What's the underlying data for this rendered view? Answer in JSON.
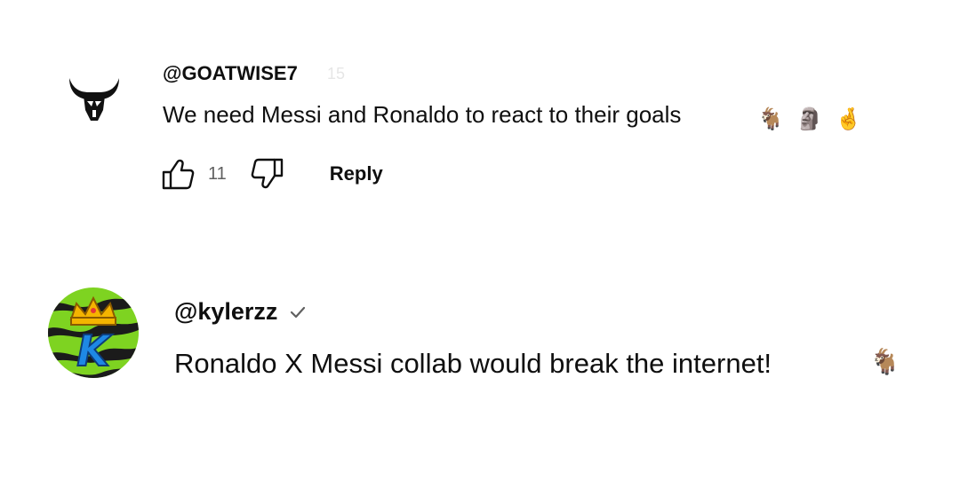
{
  "comments": [
    {
      "author": "@GOATWISE7",
      "timestamp": "15",
      "text": "We need Messi and Ronaldo to react to their goals",
      "emojis": [
        "🐐",
        "🗿",
        "🤞"
      ],
      "avatar_icon": "bull-horns-icon",
      "like_count": "11",
      "reply_label": "Reply"
    },
    {
      "author": "@kylerzz",
      "verified": true,
      "text": "Ronaldo X Messi collab would break the internet!",
      "emojis": [
        "🐐"
      ],
      "avatar_icon": "crowned-k-logo-icon",
      "avatar_letter": "K"
    }
  ],
  "colors": {
    "text": "#0f0f0f",
    "secondary": "#606060",
    "avatar2_bg": "#7ed321",
    "avatar2_stripes": "#1b1b1b",
    "crown": "#f4b400",
    "k_blue": "#1e88e5"
  }
}
